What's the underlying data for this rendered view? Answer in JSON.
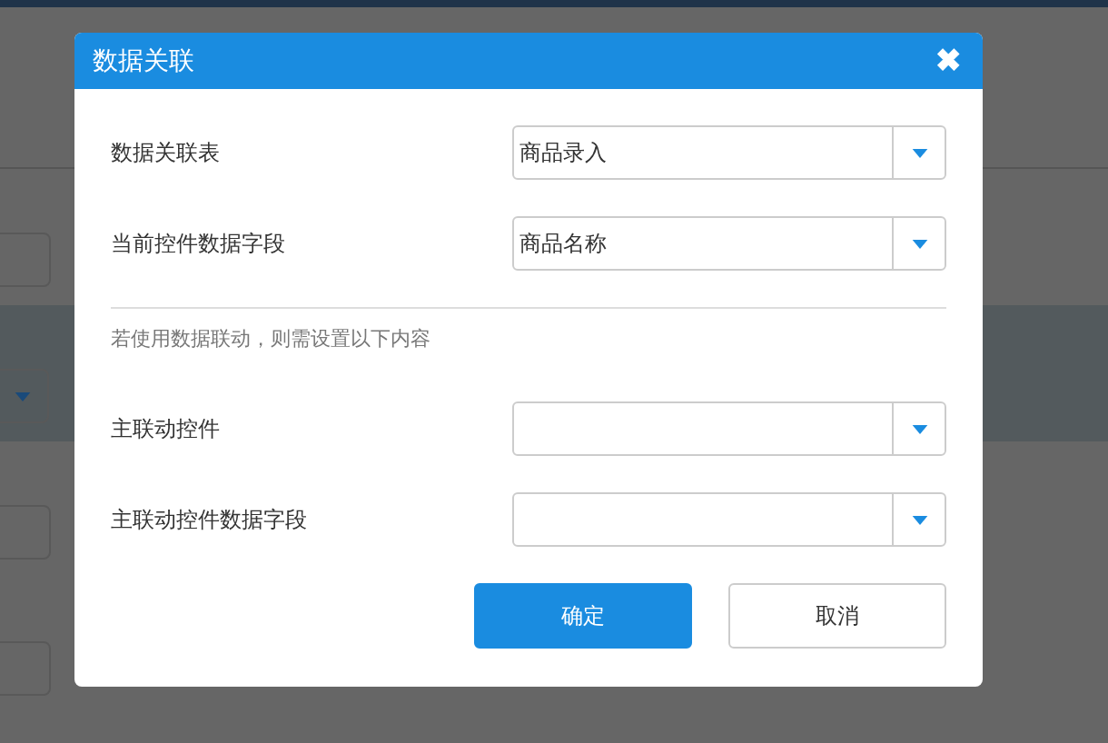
{
  "dialog": {
    "title": "数据关联",
    "close_icon": "✖",
    "fields": [
      {
        "label": "数据关联表",
        "value": "商品录入"
      },
      {
        "label": "当前控件数据字段",
        "value": "商品名称"
      }
    ],
    "hint": "若使用数据联动，则需设置以下内容",
    "linked_fields": [
      {
        "label": "主联动控件"
      },
      {
        "label": "主联动控件数据字段"
      }
    ],
    "buttons": [
      {
        "label": "确定",
        "kind": "primary"
      },
      {
        "label": "取消",
        "kind": "secondary"
      }
    ]
  }
}
